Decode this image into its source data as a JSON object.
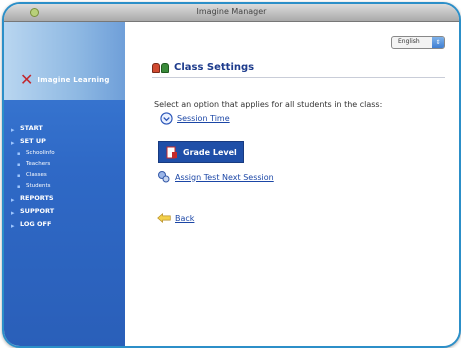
{
  "window": {
    "title": "Imagine Manager"
  },
  "brand": {
    "name": "Imagine Learning"
  },
  "nav": {
    "items": [
      {
        "label": "START",
        "sub": false
      },
      {
        "label": "SET UP",
        "sub": false
      },
      {
        "label": "Schoolinfo",
        "sub": true
      },
      {
        "label": "Teachers",
        "sub": true
      },
      {
        "label": "Classes",
        "sub": true
      },
      {
        "label": "Students",
        "sub": true
      },
      {
        "label": "REPORTS",
        "sub": false
      },
      {
        "label": "SUPPORT",
        "sub": false
      },
      {
        "label": "LOG OFF",
        "sub": false
      }
    ]
  },
  "language": {
    "selected": "English"
  },
  "page": {
    "title": "Class Settings",
    "instruction": "Select an option that applies for all students in the class:",
    "options": {
      "session_time": "Session Time",
      "grade_level": "Grade Level",
      "assign_test": "Assign Test Next Session",
      "back": "Back"
    }
  },
  "colors": {
    "accent": "#2c8fc8",
    "sidebar": "#2f69c6",
    "selected_option": "#1f4fa8",
    "link": "#1b46a6"
  }
}
